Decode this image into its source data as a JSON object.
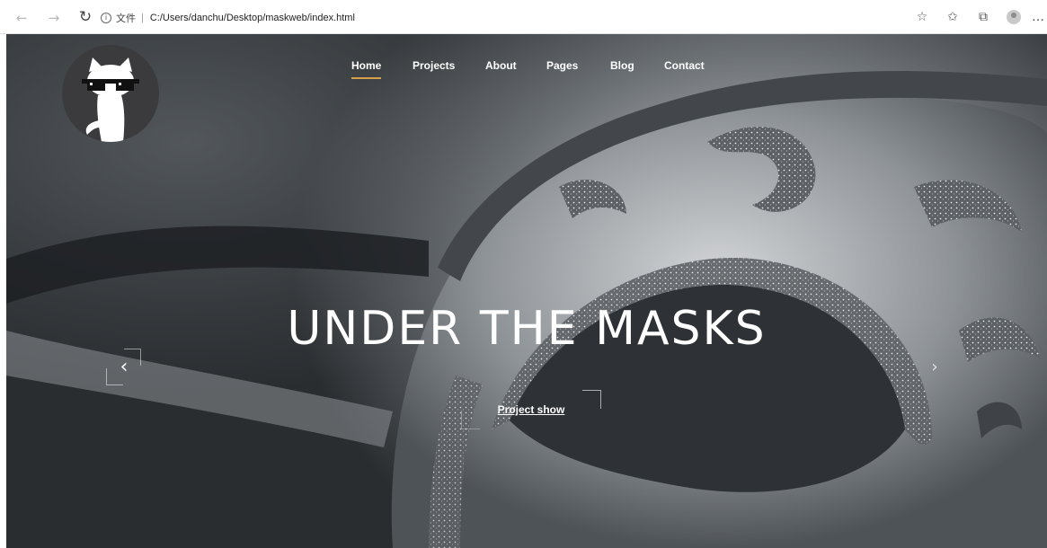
{
  "browser": {
    "back_icon": "back-arrow-icon",
    "forward_icon": "forward-arrow-icon",
    "reload_icon": "reload-icon",
    "info_icon": "info-icon",
    "scheme_label": "文件",
    "url": "C:/Users/danchu/Desktop/maskweb/index.html",
    "right_icons": [
      "favorite-add-icon",
      "favorites-icon",
      "collections-icon",
      "profile-icon",
      "more-icon"
    ]
  },
  "nav": {
    "items": [
      {
        "label": "Home",
        "active": true
      },
      {
        "label": "Projects"
      },
      {
        "label": "About"
      },
      {
        "label": "Pages"
      },
      {
        "label": "Blog"
      },
      {
        "label": "Contact"
      }
    ]
  },
  "hero": {
    "title": "UNDER THE MASKS",
    "cta_label": "Project show",
    "prev_icon": "chevron-left-icon",
    "next_icon": "chevron-right-icon"
  },
  "colors": {
    "accent_underline": "#d6a049",
    "logo_bg": "#3b3b3d",
    "hero_text": "#ffffff"
  }
}
